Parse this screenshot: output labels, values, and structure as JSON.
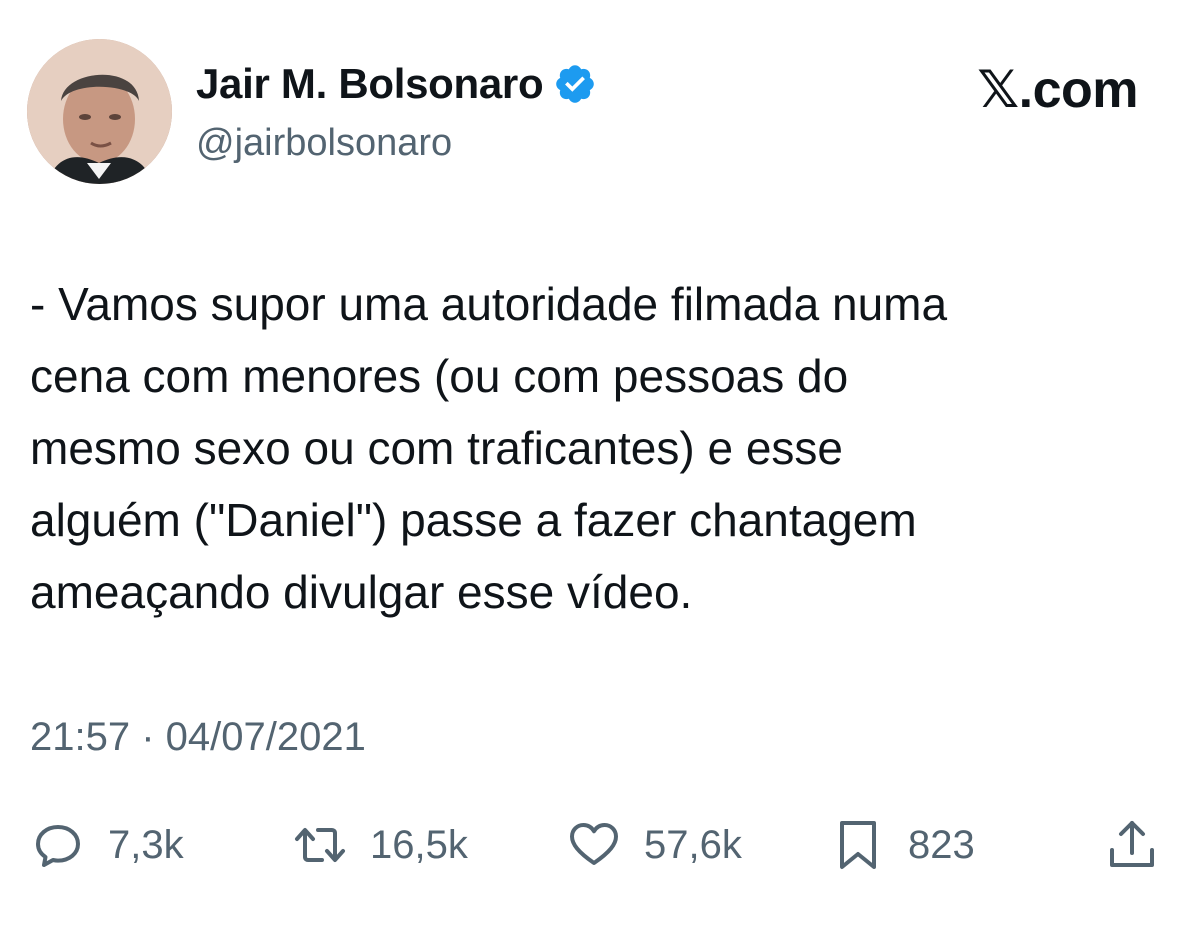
{
  "tweet": {
    "author": {
      "display_name": "Jair M. Bolsonaro",
      "handle": "@jairbolsonaro",
      "verified": true,
      "verified_color": "#1d9bf0"
    },
    "brand": "𝕏.com",
    "text": "- Vamos supor uma autoridade filmada numa\ncena com menores (ou com pessoas do\nmesmo sexo ou com traficantes) e esse\nalguém (\"Daniel\") passe a fazer chantagem\nameaçando divulgar esse vídeo.",
    "timestamp": "21:57 · 04/07/2021",
    "metrics": {
      "replies": "7,3k",
      "reposts": "16,5k",
      "likes": "57,6k",
      "bookmarks": "823"
    }
  },
  "icons": {
    "reply": "reply-icon",
    "repost": "repost-icon",
    "like": "heart-icon",
    "bookmark": "bookmark-icon",
    "share": "share-icon",
    "verified": "verified-badge-icon"
  },
  "colors": {
    "text_primary": "#0f1419",
    "text_secondary": "#536471",
    "background": "#ffffff"
  }
}
